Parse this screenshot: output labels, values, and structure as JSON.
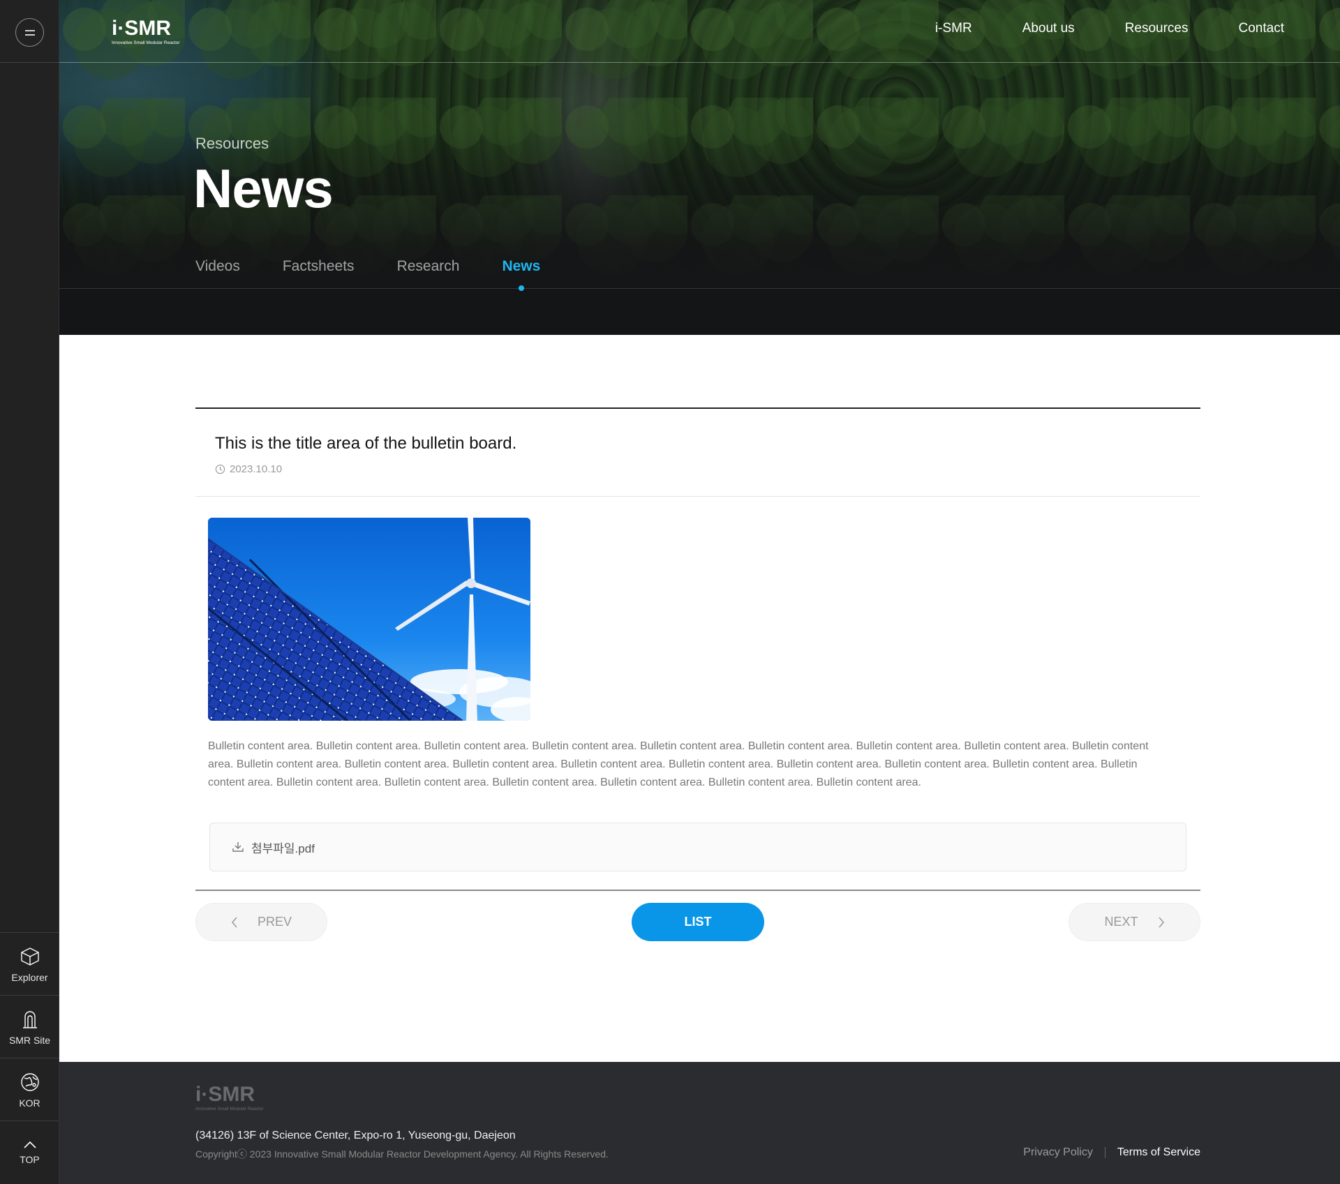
{
  "brand": {
    "logo_text": "i·SMR",
    "logo_tagline": "Innovative Small Modular Reactor"
  },
  "nav": {
    "items": [
      "i-SMR",
      "About us",
      "Resources",
      "Contact"
    ]
  },
  "sidebar": {
    "tools": [
      {
        "label": "Explorer",
        "icon": "cube-icon"
      },
      {
        "label": "SMR Site",
        "icon": "reactor-icon"
      },
      {
        "label": "KOR",
        "icon": "globe-icon"
      },
      {
        "label": "TOP",
        "icon": "chevron-up-icon"
      }
    ]
  },
  "hero": {
    "section": "Resources",
    "title": "News",
    "tabs": [
      "Videos",
      "Factsheets",
      "Research",
      "News"
    ],
    "active_tab": "News"
  },
  "post": {
    "title": "This is the title area of the bulletin board.",
    "date": "2023.10.10",
    "content": "Bulletin content area. Bulletin content area. Bulletin content area. Bulletin content area. Bulletin content area. Bulletin content area. Bulletin content area. Bulletin content area.  Bulletin content area. Bulletin content area. Bulletin content area. Bulletin content area. Bulletin content area. Bulletin content area. Bulletin content area. Bulletin content area.  Bulletin content area. Bulletin content area. Bulletin content area. Bulletin content area. Bulletin content area. Bulletin content area. Bulletin content area. Bulletin content area.",
    "attachment": "첨부파일.pdf"
  },
  "pager": {
    "prev": "PREV",
    "list": "LIST",
    "next": "NEXT"
  },
  "footer": {
    "logo_text": "i·SMR",
    "logo_tagline": "Innovative Small Modular Reactor",
    "address": "(34126) 13F of Science Center, Expo-ro 1, Yuseong-gu, Daejeon",
    "copyright": "Copyrightⓒ 2023 Innovative Small Modular Reactor Development Agency. All Rights Reserved.",
    "privacy": "Privacy Policy",
    "terms": "Terms of Service"
  },
  "colors": {
    "accent": "#1fb6f0",
    "button_primary": "#0a96e8",
    "sidebar_bg": "#222222",
    "footer_bg": "#2b2c2f"
  }
}
